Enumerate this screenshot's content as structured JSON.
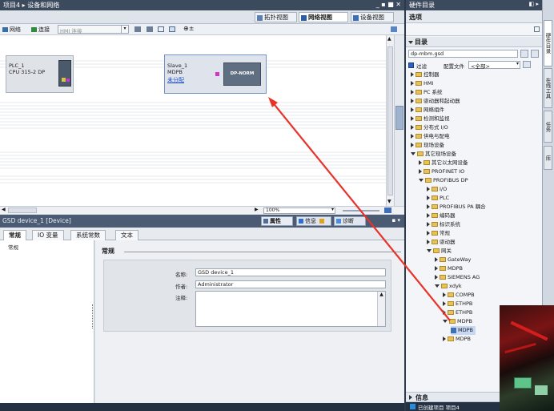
{
  "titlebar": {
    "breadcrumb": "项目4 ▸ 设备和网络",
    "controls": "_ ▪ ■ ✕"
  },
  "view_tabs": {
    "topology": "拓扑视图",
    "network": "网络视图",
    "device": "设备视图"
  },
  "toolbar": {
    "network": "网络",
    "connect": "连接",
    "hmi_conn": "HMI 连接",
    "zoom_value": "100%"
  },
  "devices": {
    "plc": {
      "name": "PLC_1",
      "type": "CPU 315-2 DP"
    },
    "slave": {
      "name": "Slave_1",
      "type": "MDPB",
      "link": "未分配",
      "module": "DP-NORM"
    }
  },
  "properties": {
    "title": "GSD device_1 [Device]",
    "tabs_right": {
      "props": "属性",
      "info": "信息",
      "diag": "诊断"
    },
    "tabs": [
      "常规",
      "IO 变量",
      "系统常数",
      "文本"
    ],
    "left_item": "常规",
    "section": "常规",
    "fields": {
      "name_label": "名称:",
      "name_value": "GSD device_1",
      "author_label": "作者:",
      "author_value": "Administrator",
      "comment_label": "注释:"
    }
  },
  "catalog": {
    "header": "硬件目录",
    "options": "选项",
    "section": "目录",
    "search_value": "dp-mbm.gsd",
    "filter_label": "过滤",
    "profile_label": "配置文件",
    "profile_value": "<全部>",
    "info_section": "信息",
    "items": [
      {
        "label": "控制器",
        "level": 0,
        "state": "r"
      },
      {
        "label": "HMI",
        "level": 0,
        "state": "r"
      },
      {
        "label": "PC 系统",
        "level": 0,
        "state": "r"
      },
      {
        "label": "驱动器和起动器",
        "level": 0,
        "state": "r"
      },
      {
        "label": "网络组件",
        "level": 0,
        "state": "r"
      },
      {
        "label": "检测和监视",
        "level": 0,
        "state": "r"
      },
      {
        "label": "分布式 I/O",
        "level": 0,
        "state": "r"
      },
      {
        "label": "供电与配电",
        "level": 0,
        "state": "r"
      },
      {
        "label": "现场设备",
        "level": 0,
        "state": "r"
      },
      {
        "label": "其它现场设备",
        "level": 0,
        "state": "d"
      },
      {
        "label": "其它以太网设备",
        "level": 1,
        "state": "r"
      },
      {
        "label": "PROFINET IO",
        "level": 1,
        "state": "r"
      },
      {
        "label": "PROFIBUS DP",
        "level": 1,
        "state": "d"
      },
      {
        "label": "I/O",
        "level": 2,
        "state": "r"
      },
      {
        "label": "PLC",
        "level": 2,
        "state": "r"
      },
      {
        "label": "PROFIBUS PA 耦合",
        "level": 2,
        "state": "r"
      },
      {
        "label": "编码器",
        "level": 2,
        "state": "r"
      },
      {
        "label": "标识系统",
        "level": 2,
        "state": "r"
      },
      {
        "label": "常规",
        "level": 2,
        "state": "r"
      },
      {
        "label": "驱动器",
        "level": 2,
        "state": "r"
      },
      {
        "label": "网关",
        "level": 2,
        "state": "d"
      },
      {
        "label": "GateWay",
        "level": 3,
        "state": "r"
      },
      {
        "label": "MDPB",
        "level": 3,
        "state": "r"
      },
      {
        "label": "SIEMENS AG",
        "level": 3,
        "state": "r"
      },
      {
        "label": "xdyk",
        "level": 3,
        "state": "d"
      },
      {
        "label": "COMPB",
        "level": 4,
        "state": "r"
      },
      {
        "label": "ETHPB",
        "level": 4,
        "state": "r"
      },
      {
        "label": "ETHPB",
        "level": 4,
        "state": "r"
      },
      {
        "label": "MDPB",
        "level": 4,
        "state": "d"
      },
      {
        "label": "MDPB",
        "level": 5,
        "state": "sel"
      },
      {
        "label": "MDPB",
        "level": 4,
        "state": "r"
      }
    ]
  },
  "side_tabs": [
    "硬件目录",
    "在线工具",
    "任务",
    "库"
  ],
  "status": {
    "text": "已创建项目 项目4"
  }
}
